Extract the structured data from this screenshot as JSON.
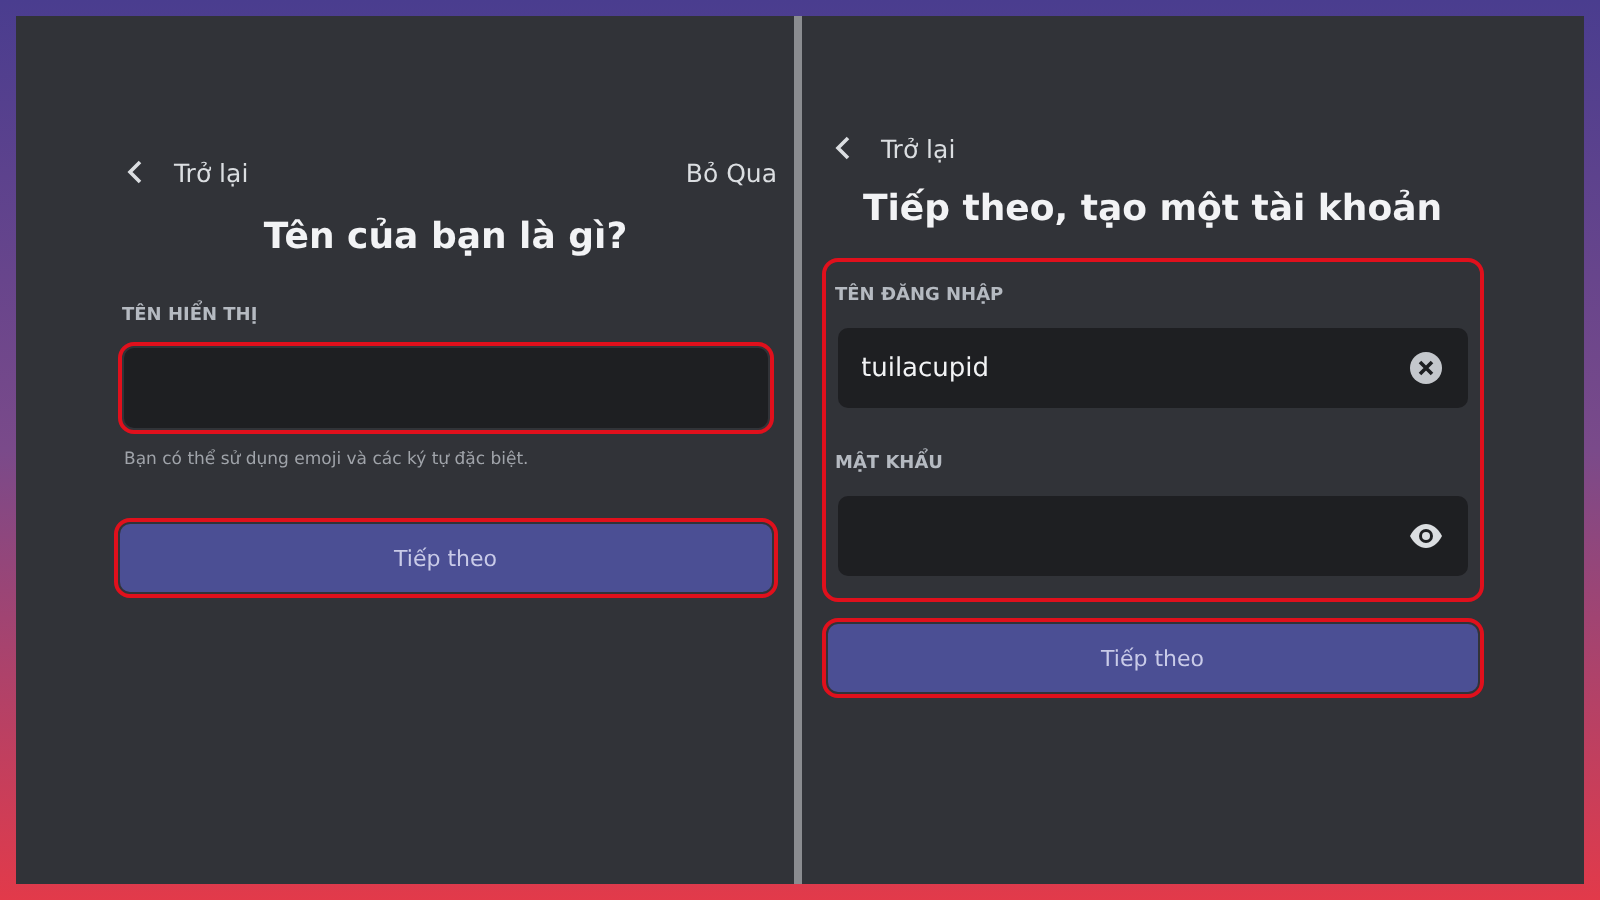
{
  "screens": [
    {
      "back": "Trở lại",
      "skip": "Bỏ Qua",
      "title": "Tên của bạn là gì?",
      "fields_highlighted": false,
      "fields": [
        {
          "label": "TÊN HIỂN THỊ",
          "kind": "plain",
          "highlighted": true,
          "hint": "Bạn có thể sử dụng emoji và các ký tự đặc biệt."
        }
      ],
      "button": {
        "label": "Tiếp theo",
        "highlighted": true
      }
    },
    {
      "back": "Trở lại",
      "title": "Tiếp theo, tạo một tài khoản",
      "fields_highlighted": true,
      "fields": [
        {
          "label": "TÊN ĐĂNG NHẬP",
          "value": "tuilacupid",
          "kind": "clearable",
          "highlighted": false
        },
        {
          "label": "MẬT KHẨU",
          "kind": "password",
          "highlighted": false
        }
      ],
      "button": {
        "label": "Tiếp theo",
        "highlighted": true
      }
    }
  ]
}
